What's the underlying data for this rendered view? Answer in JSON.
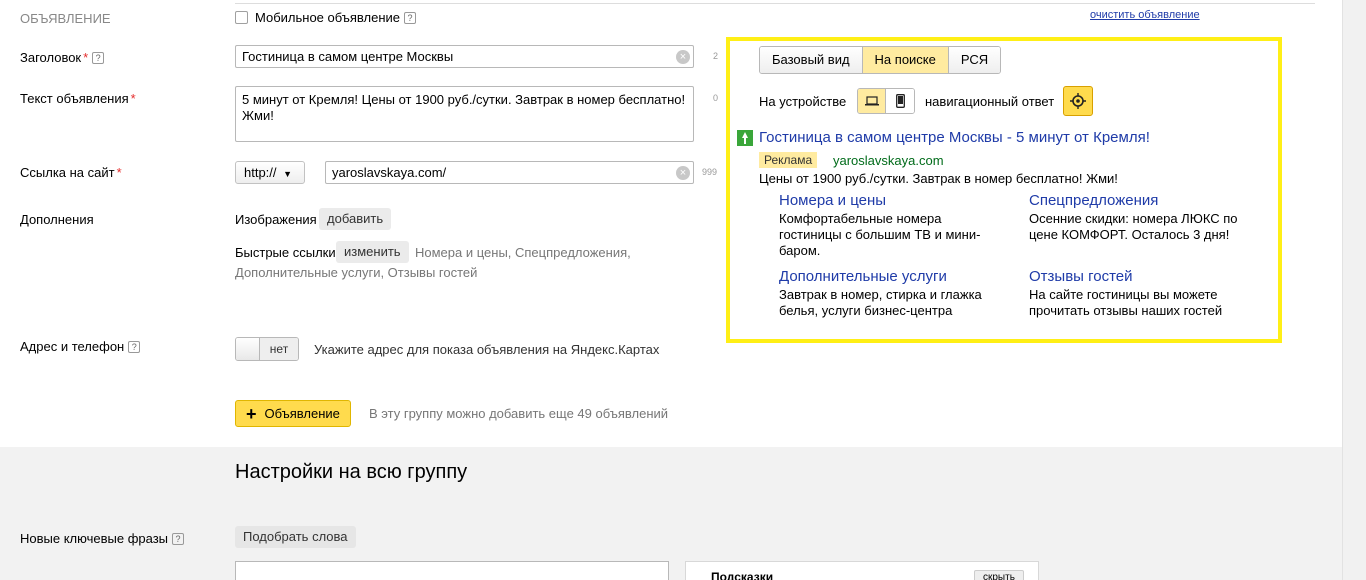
{
  "form": {
    "section_label": "ОБЪЯВЛЕНИЕ",
    "mobile_ad_label": "Мобильное объявление",
    "help_glyph": "?",
    "clear_ad_link": "очистить объявление",
    "headline": {
      "label": "Заголовок",
      "required": "*",
      "value": "Гостиница в самом центре Москвы",
      "counter": "2"
    },
    "ad_text": {
      "label": "Текст объявления",
      "required": "*",
      "value": "5 минут от Кремля! Цены от 1900 руб./сутки. Завтрак в номер бесплатно! Жми!",
      "counter": "0"
    },
    "site_link": {
      "label": "Ссылка на сайт",
      "required": "*",
      "protocol": "http://",
      "value": "yaroslavskaya.com/",
      "counter": "999"
    },
    "extras": {
      "label": "Дополнения",
      "images_label": "Изображения",
      "images_button": "добавить",
      "quick_links_label": "Быстрые ссылки",
      "quick_links_button": "изменить",
      "quick_links_list_line1": "Номера и цены, Спецпредложения,",
      "quick_links_list_line2": "Дополнительные услуги, Отзывы гостей"
    },
    "address": {
      "label": "Адрес и телефон",
      "toggle_state": "нет",
      "hint": "Укажите адрес для показа объявления на Яндекс.Картах"
    },
    "add_ad": {
      "icon": "+",
      "label": "Объявление",
      "hint": "В эту группу можно добавить еще 49 объявлений"
    }
  },
  "preview": {
    "tabs": [
      "Базовый вид",
      "На поиске",
      "РСЯ"
    ],
    "active_tab": "На поиске",
    "device_label": "На устройстве",
    "nav_answer_label": "навигационный ответ",
    "ad": {
      "title": "Гостиница в самом центре Москвы - 5 минут от Кремля!",
      "badge": "Реклама",
      "url": "yaroslavskaya.com",
      "text": "Цены от 1900 руб./сутки. Завтрак в номер бесплатно! Жми!"
    },
    "sitelinks": [
      {
        "title": "Номера и цены",
        "desc": "Комфортабельные номера гостиницы с большим ТВ и мини-баром."
      },
      {
        "title": "Спецпредложения",
        "desc": "Осенние скидки: номера ЛЮКС по цене КОМФОРТ. Осталось 3 дня!"
      },
      {
        "title": "Дополнительные услуги",
        "desc": "Завтрак в номер, стирка и глажка белья, услуги бизнес-центра"
      },
      {
        "title": "Отзывы гостей",
        "desc": "На сайте гостиницы вы можете прочитать отзывы наших гостей"
      }
    ],
    "highlight_color": "#ffef16"
  },
  "group": {
    "title": "Настройки на всю группу",
    "keywords_label": "Новые ключевые фразы",
    "pick_words_button": "Подобрать слова",
    "hints_title": "Подсказки",
    "hide_button": "скрыть"
  },
  "colors": {
    "link": "#1f3ba8",
    "accent": "#ffdb4d",
    "url_green": "#006b1a",
    "required": "#e52b2b"
  }
}
